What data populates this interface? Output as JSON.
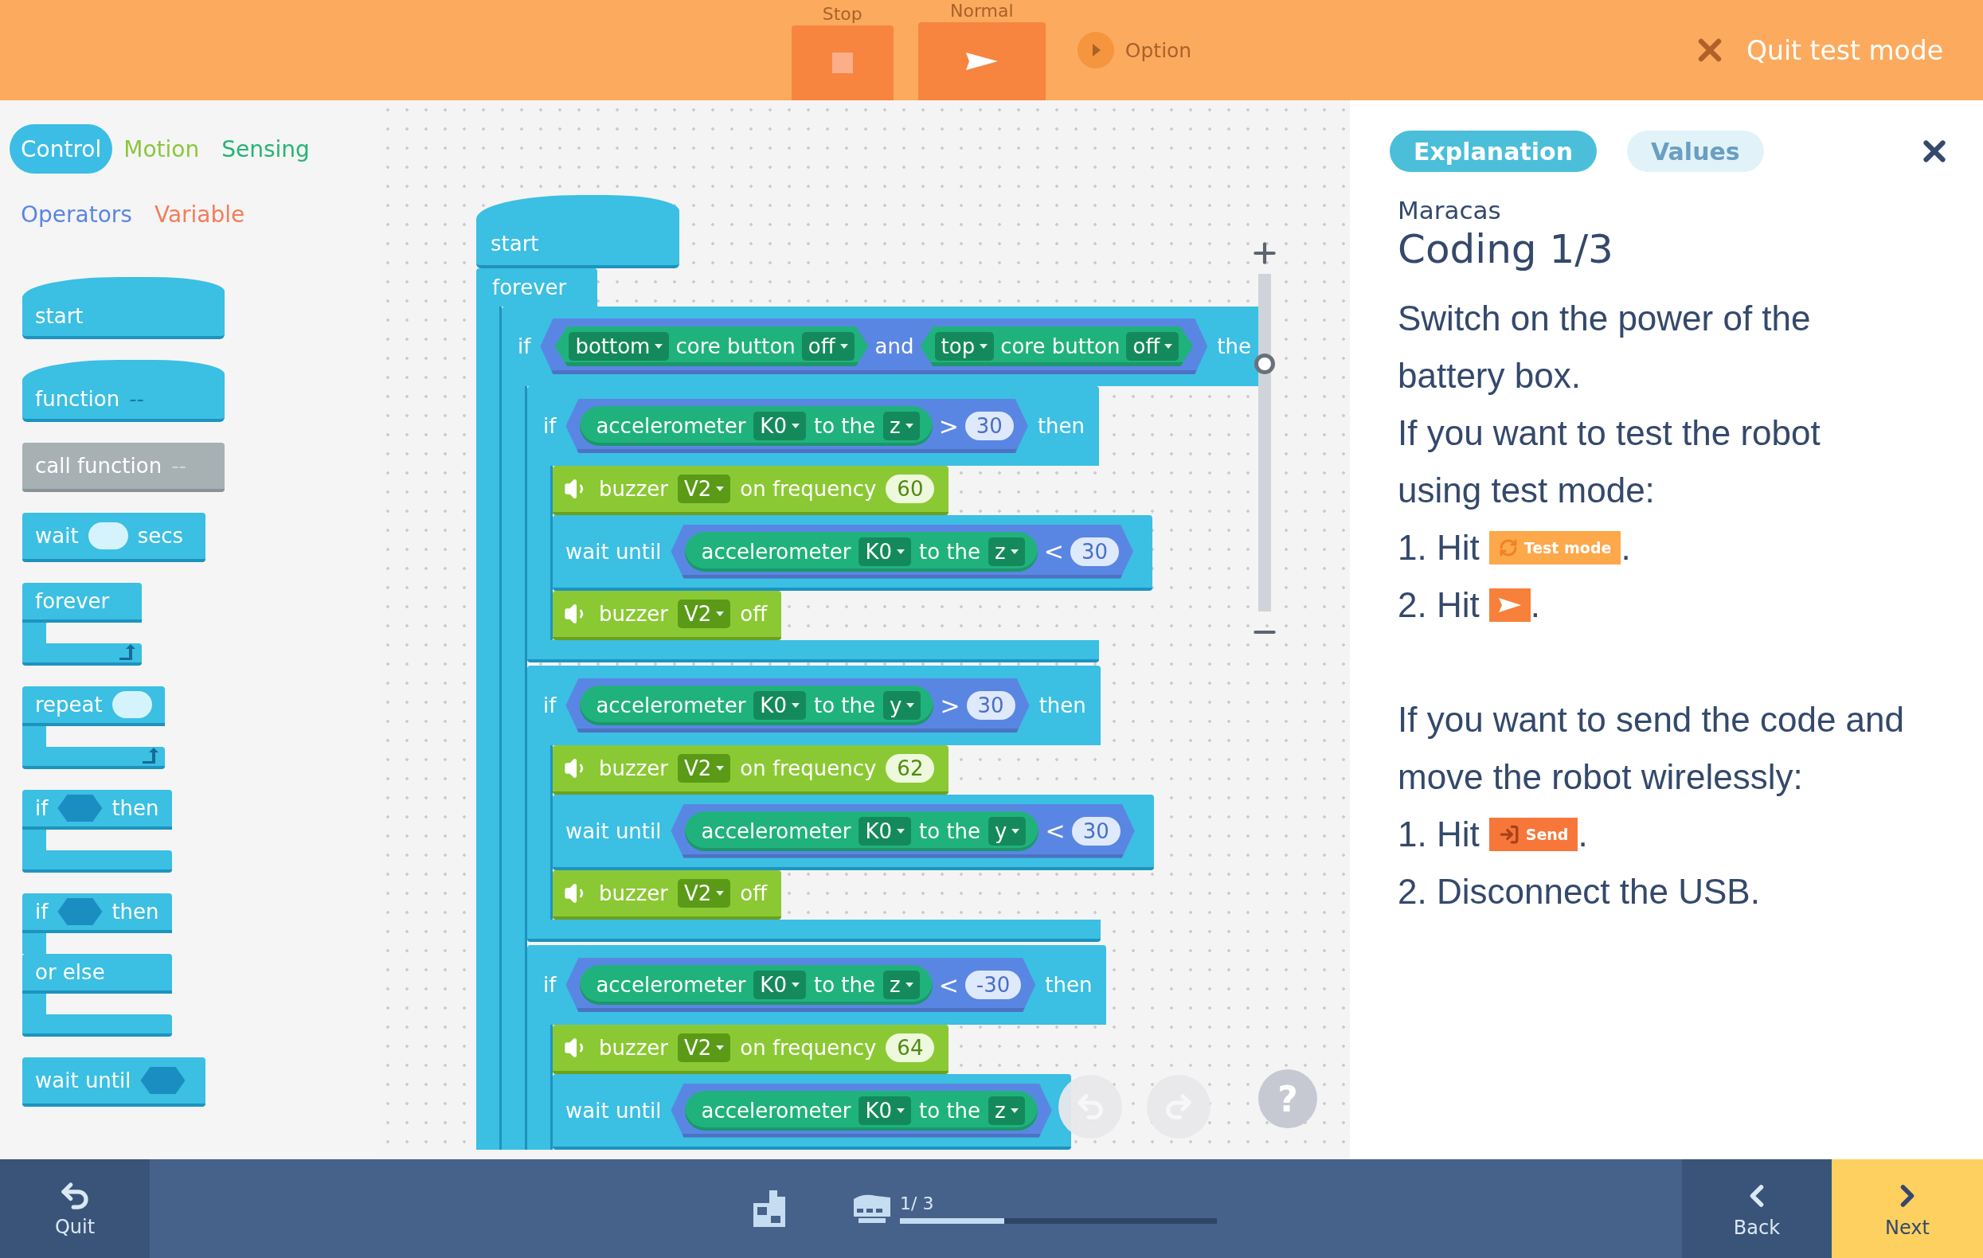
{
  "toolbar": {
    "modes": [
      {
        "kind": "stop",
        "label": "Stop",
        "selected": false
      },
      {
        "kind": "play",
        "label": "Normal",
        "selected": true
      }
    ],
    "option": "Option",
    "quit": "Quit test mode"
  },
  "palette": {
    "categories": [
      {
        "label": "Control",
        "selected": true,
        "color": "#3cbde5"
      },
      {
        "label": "Motion",
        "selected": false,
        "color": "#8cc63f"
      },
      {
        "label": "Sensing",
        "selected": false,
        "color": "#27b37a"
      },
      {
        "label": "Operators",
        "selected": false,
        "color": "#5b87e0"
      },
      {
        "label": "Variable",
        "selected": false,
        "color": "#f47d5b"
      }
    ],
    "blocks": [
      {
        "kind": "hat",
        "label": "start"
      },
      {
        "kind": "hat",
        "label": "function",
        "suffix": "--"
      },
      {
        "kind": "call",
        "label": "call function",
        "suffix": "--"
      },
      {
        "kind": "stack",
        "label": "wait",
        "slot": {
          "kind": "oval"
        },
        "after": "secs"
      },
      {
        "kind": "loop",
        "label": "forever"
      },
      {
        "kind": "loop",
        "label": "repeat",
        "slot": {
          "kind": "oval"
        }
      },
      {
        "kind": "if",
        "label": "if",
        "slot": {
          "kind": "hex"
        },
        "after": "then"
      },
      {
        "kind": "ifelse",
        "label": "if",
        "slot": {
          "kind": "hex"
        },
        "after": "then",
        "else": "or else"
      },
      {
        "kind": "stack",
        "label": "wait until",
        "slot": {
          "kind": "hex"
        }
      }
    ]
  },
  "script": {
    "hat": "start",
    "loop": "forever",
    "blocks": [
      {
        "kind": "if",
        "label": "if",
        "after": "the",
        "condition": {
          "kind": "and",
          "joiner": "and",
          "left": {
            "side": "bottom",
            "label": "core button",
            "state": "off"
          },
          "right": {
            "side": "top",
            "label": "core button",
            "state": "off"
          }
        },
        "body": [
          {
            "kind": "if",
            "label": "if",
            "after": "then",
            "condition": {
              "kind": "compare",
              "sensor": "accelerometer",
              "port": "K0",
              "label": "to the",
              "axis": "z",
              "op": ">",
              "value": "30"
            },
            "body": [
              {
                "kind": "buzzer",
                "label": "buzzer",
                "port": "V2",
                "action": "on frequency",
                "value": "60"
              },
              {
                "kind": "wait",
                "label": "wait until",
                "condition": {
                  "kind": "compare",
                  "sensor": "accelerometer",
                  "port": "K0",
                  "label": "to the",
                  "axis": "z",
                  "op": "<",
                  "value": "30"
                }
              },
              {
                "kind": "buzzer",
                "label": "buzzer",
                "port": "V2",
                "action": "off"
              }
            ]
          },
          {
            "kind": "if",
            "label": "if",
            "after": "then",
            "condition": {
              "kind": "compare",
              "sensor": "accelerometer",
              "port": "K0",
              "label": "to the",
              "axis": "y",
              "op": ">",
              "value": "30"
            },
            "body": [
              {
                "kind": "buzzer",
                "label": "buzzer",
                "port": "V2",
                "action": "on frequency",
                "value": "62"
              },
              {
                "kind": "wait",
                "label": "wait until",
                "condition": {
                  "kind": "compare",
                  "sensor": "accelerometer",
                  "port": "K0",
                  "label": "to the",
                  "axis": "y",
                  "op": "<",
                  "value": "30"
                }
              },
              {
                "kind": "buzzer",
                "label": "buzzer",
                "port": "V2",
                "action": "off"
              }
            ]
          },
          {
            "kind": "if",
            "label": "if",
            "after": "then",
            "condition": {
              "kind": "compare",
              "sensor": "accelerometer",
              "port": "K0",
              "label": "to the",
              "axis": "z",
              "op": "<",
              "value": "-30"
            },
            "body": [
              {
                "kind": "buzzer",
                "label": "buzzer",
                "port": "V2",
                "action": "on frequency",
                "value": "64"
              },
              {
                "kind": "wait",
                "label": "wait until",
                "condition": {
                  "kind": "compare",
                  "sensor": "accelerometer",
                  "port": "K0",
                  "label": "to the",
                  "axis": "z"
                }
              }
            ]
          }
        ]
      }
    ]
  },
  "canvas": {
    "zoom": {
      "level": 0.75
    },
    "help": "?"
  },
  "panel": {
    "tabs": [
      {
        "label": "Explanation",
        "selected": true
      },
      {
        "label": "Values",
        "selected": false
      }
    ],
    "project": "Maracas",
    "title": "Coding 1/3",
    "sections": [
      [
        {
          "kind": "text",
          "text": "Switch on the power of the battery box."
        },
        {
          "kind": "text",
          "text": "If you want to test the robot using test mode:"
        },
        {
          "kind": "step",
          "prefix": "1. Hit",
          "badge": {
            "kind": "test",
            "label": "Test mode"
          },
          "suffix": "."
        },
        {
          "kind": "step",
          "prefix": "2. Hit",
          "badge": {
            "kind": "play"
          },
          "suffix": "."
        }
      ],
      [
        {
          "kind": "text",
          "text": "If you want to send the code and move the robot wirelessly:"
        },
        {
          "kind": "step",
          "prefix": "1. Hit",
          "badge": {
            "kind": "send",
            "label": "Send"
          },
          "suffix": "."
        },
        {
          "kind": "text",
          "text": "2. Disconnect the USB."
        }
      ]
    ]
  },
  "bottom": {
    "quit": "Quit",
    "progress": {
      "label": "1/ 3",
      "level": 0.33
    },
    "back": "Back",
    "next": "Next"
  }
}
